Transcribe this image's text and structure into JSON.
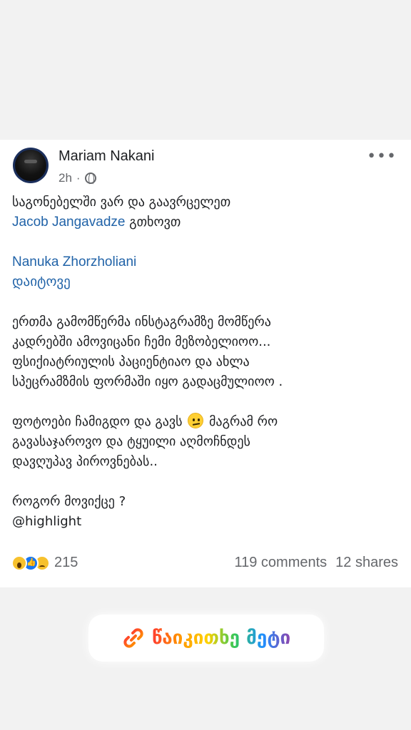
{
  "post": {
    "author": "Mariam Nakani",
    "time": "2h",
    "separator": "·",
    "more_label": "•••",
    "lines": {
      "l1": "საგონებელში ვარ და გაავრცელეთ",
      "l2_link": "Jacob Jangavadze",
      "l2_rest": " გთხოვთ",
      "l3_link": "Nanuka Zhorzholiani",
      "l4": "დაიტოვე",
      "l5": "ერთმა გამომწერმა ინსტაგრამზე   მომწერა",
      "l6": "კადრებში ამოვიცანი ჩემი მეზობელიოო...",
      "l7": "ფსიქიატრიულის პაციენტიაო და ახლა",
      "l8": "სპეცრამზმის ფორმაში იყო გადაცმულიოო .",
      "l9a": "ფოტოები ჩამიგდო და გავს ",
      "l9b": " მაგრამ რო",
      "l10": "გავასაჯაროვო და ტყუილი აღმოჩნდეს",
      "l11": "დავღუპავ პიროვნებას..",
      "l12": "როგორ მოვიქცე ?",
      "l13": "@highlight"
    },
    "reactions_count": "215",
    "comments": "119 comments",
    "shares": "12 shares"
  },
  "overlay": {
    "read_more_label": "წაიკითხე მეტი"
  },
  "colors": {
    "link": "#2163a8",
    "text": "#1c1e21",
    "meta": "#65676b",
    "background": "#f2f2f2"
  },
  "icons": [
    "globe-icon",
    "more-options-icon",
    "wow-reaction-icon",
    "like-reaction-icon",
    "sad-reaction-icon",
    "confused-face-emoji",
    "link-icon"
  ]
}
